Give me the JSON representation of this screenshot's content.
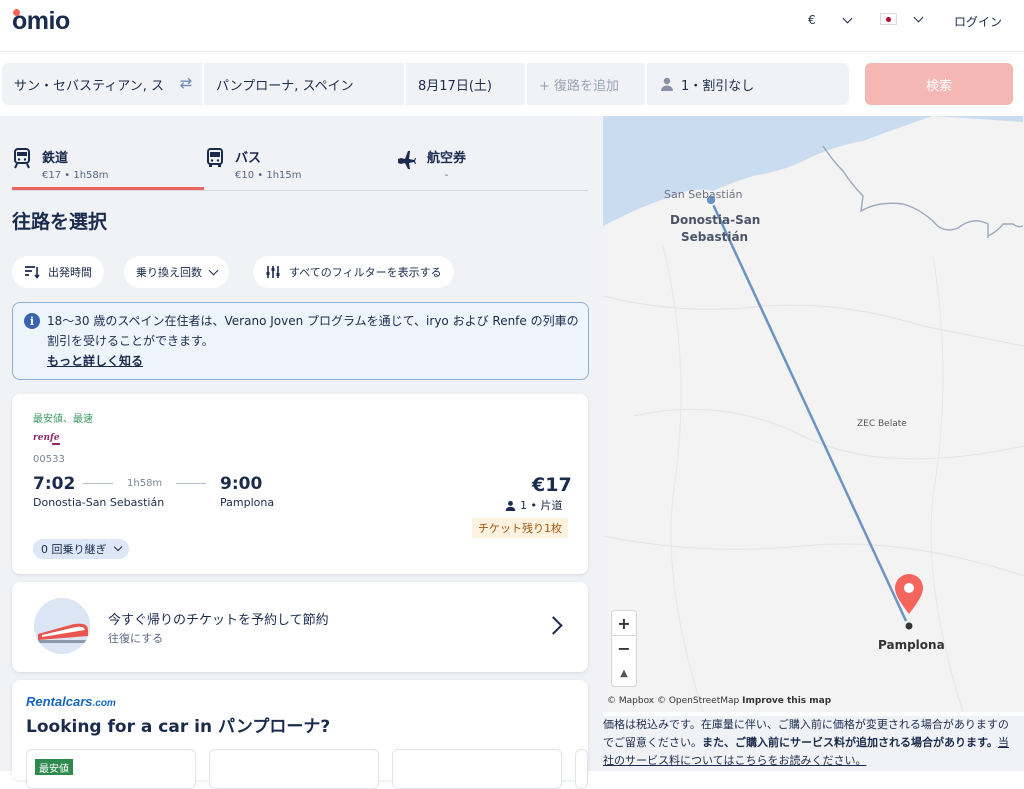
{
  "header": {
    "logo": "omio",
    "currency": "€",
    "login": "ログイン"
  },
  "search": {
    "origin": "サン・セバスティアン, ス",
    "destination": "パンプローナ, スペイン",
    "date": "8月17日(土)",
    "return_placeholder": "+ 復路を追加",
    "passengers": "1・割引なし",
    "search_button": "検索"
  },
  "tabs": [
    {
      "name": "鉄道",
      "sub": "€17 • 1h58m"
    },
    {
      "name": "バス",
      "sub": "€10 • 1h15m"
    },
    {
      "name": "航空券",
      "sub": "-"
    }
  ],
  "page_title": "往路を選択",
  "filters": {
    "departure_time": "出発時間",
    "transfers": "乗り換え回数",
    "all_filters": "すべてのフィルターを表示する"
  },
  "info": {
    "text": "18～30 歳のスペイン在住者は、Verano Joven プログラムを通じて、iryo および Renfe の列車の割引を受けることができます。",
    "link": "もっと詳しく知る"
  },
  "result": {
    "badge": "最安値、最速",
    "operator_logo": "renfe",
    "train_number": "00533",
    "depart_time": "7:02",
    "depart_station": "Donostia-San Sebastián",
    "duration": "1h58m",
    "arrive_time": "9:00",
    "arrive_station": "Pamplona",
    "price": "€17",
    "fare_type": "1 • 片道",
    "tickets_left": "チケット残り1枚",
    "transfers": "0 回乗り継ぎ"
  },
  "return_promo": {
    "title": "今すぐ帰りのチケットを予約して節約",
    "subtitle": "往復にする"
  },
  "rental": {
    "brand": "Rentalcars",
    "brand_suffix": ".com",
    "title": "Looking for a car in パンプローナ?",
    "badge": "最安値"
  },
  "map": {
    "label_ss_small": "San Sebastián",
    "label_ss_1": "Donostia-San",
    "label_ss_2": "Sebastián",
    "label_zec": "ZEC Belate",
    "label_pamplona": "Pamplona",
    "zoom_in": "+",
    "zoom_out": "−",
    "compass": "▲",
    "attribution": "© Mapbox © OpenStreetMap",
    "improve": "Improve this map",
    "route_color": "#6b93c8",
    "pin_color": "#f4655e"
  },
  "disclaimer": {
    "part1": "価格は税込みです。在庫量に伴い、ご購入前に価格が変更される場合がありますのでご留意ください。",
    "part2": "また、ご購入前にサービス料が追加される場合があります。",
    "link": "当社のサービス料についてはこちらをお読みください。"
  },
  "colors": {
    "brand": "#1b2b4d",
    "accent": "#f4655e",
    "search_button": "#f5b7b3"
  }
}
